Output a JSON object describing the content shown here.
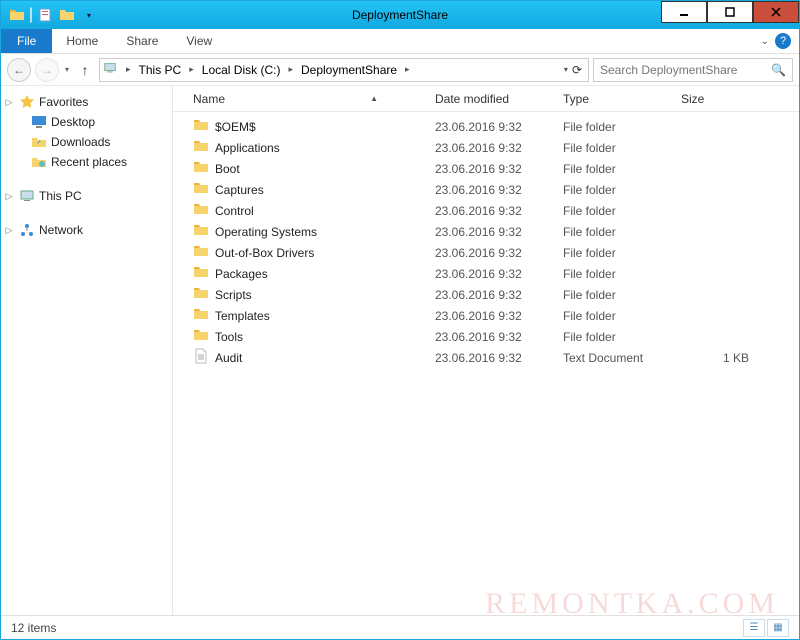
{
  "window": {
    "title": "DeploymentShare"
  },
  "ribbon": {
    "file": "File",
    "tabs": [
      "Home",
      "Share",
      "View"
    ]
  },
  "breadcrumb": {
    "root_icon": "this-pc",
    "crumbs": [
      "This PC",
      "Local Disk (C:)",
      "DeploymentShare"
    ]
  },
  "search": {
    "placeholder": "Search DeploymentShare"
  },
  "nav": {
    "favorites": {
      "label": "Favorites",
      "items": [
        {
          "icon": "desktop",
          "label": "Desktop"
        },
        {
          "icon": "downloads",
          "label": "Downloads"
        },
        {
          "icon": "recent",
          "label": "Recent places"
        }
      ]
    },
    "this_pc": {
      "label": "This PC"
    },
    "network": {
      "label": "Network"
    }
  },
  "columns": {
    "name": "Name",
    "date": "Date modified",
    "type": "Type",
    "size": "Size"
  },
  "items": [
    {
      "icon": "folder",
      "name": "$OEM$",
      "date": "23.06.2016 9:32",
      "type": "File folder",
      "size": ""
    },
    {
      "icon": "folder",
      "name": "Applications",
      "date": "23.06.2016 9:32",
      "type": "File folder",
      "size": ""
    },
    {
      "icon": "folder",
      "name": "Boot",
      "date": "23.06.2016 9:32",
      "type": "File folder",
      "size": ""
    },
    {
      "icon": "folder",
      "name": "Captures",
      "date": "23.06.2016 9:32",
      "type": "File folder",
      "size": ""
    },
    {
      "icon": "folder",
      "name": "Control",
      "date": "23.06.2016 9:32",
      "type": "File folder",
      "size": ""
    },
    {
      "icon": "folder",
      "name": "Operating Systems",
      "date": "23.06.2016 9:32",
      "type": "File folder",
      "size": ""
    },
    {
      "icon": "folder",
      "name": "Out-of-Box Drivers",
      "date": "23.06.2016 9:32",
      "type": "File folder",
      "size": ""
    },
    {
      "icon": "folder",
      "name": "Packages",
      "date": "23.06.2016 9:32",
      "type": "File folder",
      "size": ""
    },
    {
      "icon": "folder",
      "name": "Scripts",
      "date": "23.06.2016 9:32",
      "type": "File folder",
      "size": ""
    },
    {
      "icon": "folder",
      "name": "Templates",
      "date": "23.06.2016 9:32",
      "type": "File folder",
      "size": ""
    },
    {
      "icon": "folder",
      "name": "Tools",
      "date": "23.06.2016 9:32",
      "type": "File folder",
      "size": ""
    },
    {
      "icon": "text",
      "name": "Audit",
      "date": "23.06.2016 9:32",
      "type": "Text Document",
      "size": "1 KB"
    }
  ],
  "status": {
    "count": "12 items"
  },
  "watermark": "REMONTKA.COM"
}
